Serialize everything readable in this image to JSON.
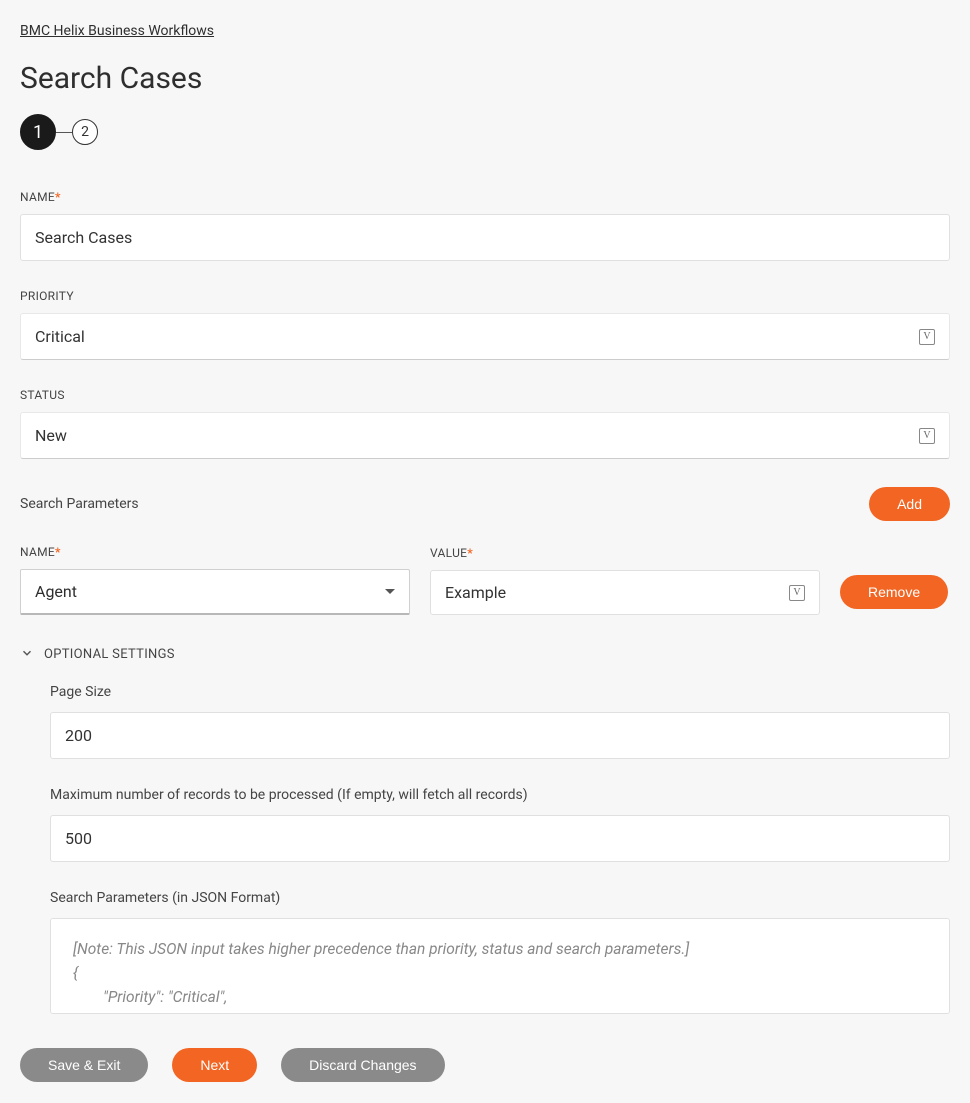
{
  "breadcrumb": "BMC Helix Business Workflows",
  "page_title": "Search Cases",
  "steps": {
    "one": "1",
    "two": "2"
  },
  "fields": {
    "name_label": "NAME",
    "name_value": "Search Cases",
    "priority_label": "PRIORITY",
    "priority_value": "Critical",
    "status_label": "STATUS",
    "status_value": "New"
  },
  "search_params": {
    "header": "Search Parameters",
    "add_label": "Add",
    "remove_label": "Remove",
    "name_label": "NAME",
    "value_label": "VALUE",
    "row": {
      "name": "Agent",
      "value": "Example"
    }
  },
  "optional": {
    "header": "OPTIONAL SETTINGS",
    "page_size_label": "Page Size",
    "page_size_value": "200",
    "max_records_label": "Maximum number of records to be processed (If empty, will fetch all records)",
    "max_records_value": "500",
    "json_label": "Search Parameters (in JSON Format)",
    "json_placeholder_line1": "[Note: This JSON input takes higher precedence than priority, status and search parameters.]",
    "json_placeholder_line2": "{",
    "json_placeholder_line3": "\"Priority\": \"Critical\","
  },
  "footer": {
    "save_exit": "Save & Exit",
    "next": "Next",
    "discard": "Discard Changes"
  },
  "glyph_v": "V"
}
